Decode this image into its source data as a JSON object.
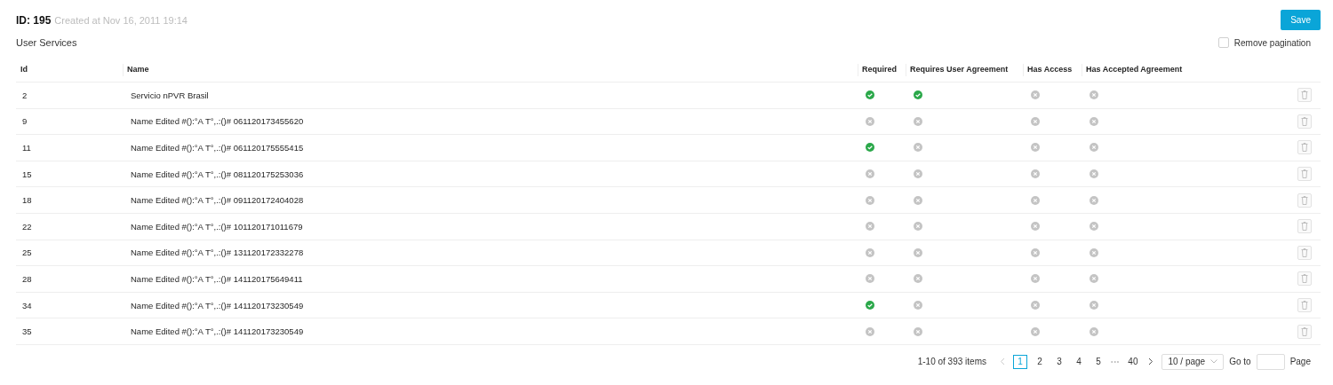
{
  "header": {
    "id_label": "ID: 195",
    "created": "Created at Nov 16, 2011 19:14",
    "save_button": "Save"
  },
  "section_title": "User Services",
  "remove_pagination": {
    "label": "Remove pagination",
    "checked": false
  },
  "table": {
    "columns": [
      "Id",
      "Name",
      "Required",
      "Requires User Agreement",
      "Has Access",
      "Has Accepted Agreement"
    ],
    "rows": [
      {
        "id": "2",
        "name": "Servicio nPVR Brasil",
        "required": true,
        "requires_agreement": true,
        "has_access": false,
        "has_accepted": false
      },
      {
        "id": "9",
        "name": "Name Edited #():°A T°,.:()# 061120173455620",
        "required": false,
        "requires_agreement": false,
        "has_access": false,
        "has_accepted": false
      },
      {
        "id": "11",
        "name": "Name Edited #():°A T°,.:()# 061120175555415",
        "required": true,
        "requires_agreement": false,
        "has_access": false,
        "has_accepted": false
      },
      {
        "id": "15",
        "name": "Name Edited #():°A T°,.:()# 081120175253036",
        "required": false,
        "requires_agreement": false,
        "has_access": false,
        "has_accepted": false
      },
      {
        "id": "18",
        "name": "Name Edited #():°A T°,.:()# 091120172404028",
        "required": false,
        "requires_agreement": false,
        "has_access": false,
        "has_accepted": false
      },
      {
        "id": "22",
        "name": "Name Edited #():°A T°,.:()# 101120171011679",
        "required": false,
        "requires_agreement": false,
        "has_access": false,
        "has_accepted": false
      },
      {
        "id": "25",
        "name": "Name Edited #():°A T°,.:()# 131120172332278",
        "required": false,
        "requires_agreement": false,
        "has_access": false,
        "has_accepted": false
      },
      {
        "id": "28",
        "name": "Name Edited #():°A T°,.:()# 141120175649411",
        "required": false,
        "requires_agreement": false,
        "has_access": false,
        "has_accepted": false
      },
      {
        "id": "34",
        "name": "Name Edited #():°A T°,.:()# 141120173230549",
        "required": true,
        "requires_agreement": false,
        "has_access": false,
        "has_accepted": false
      },
      {
        "id": "35",
        "name": "Name Edited #():°A T°,.:()# 141120173230549",
        "required": false,
        "requires_agreement": false,
        "has_access": false,
        "has_accepted": false
      }
    ]
  },
  "pagination": {
    "total": "1-10 of 393 items",
    "pages": [
      {
        "label": "1",
        "selected": true
      },
      {
        "label": "2",
        "selected": false
      },
      {
        "label": "3",
        "selected": false
      },
      {
        "label": "4",
        "selected": false
      },
      {
        "label": "5",
        "selected": false
      },
      {
        "label": "•••",
        "kind": "ellipsis"
      },
      {
        "label": "40",
        "selected": false
      }
    ],
    "page_size": "10 / page",
    "goto_label": "Go to",
    "page_label": "Page"
  }
}
